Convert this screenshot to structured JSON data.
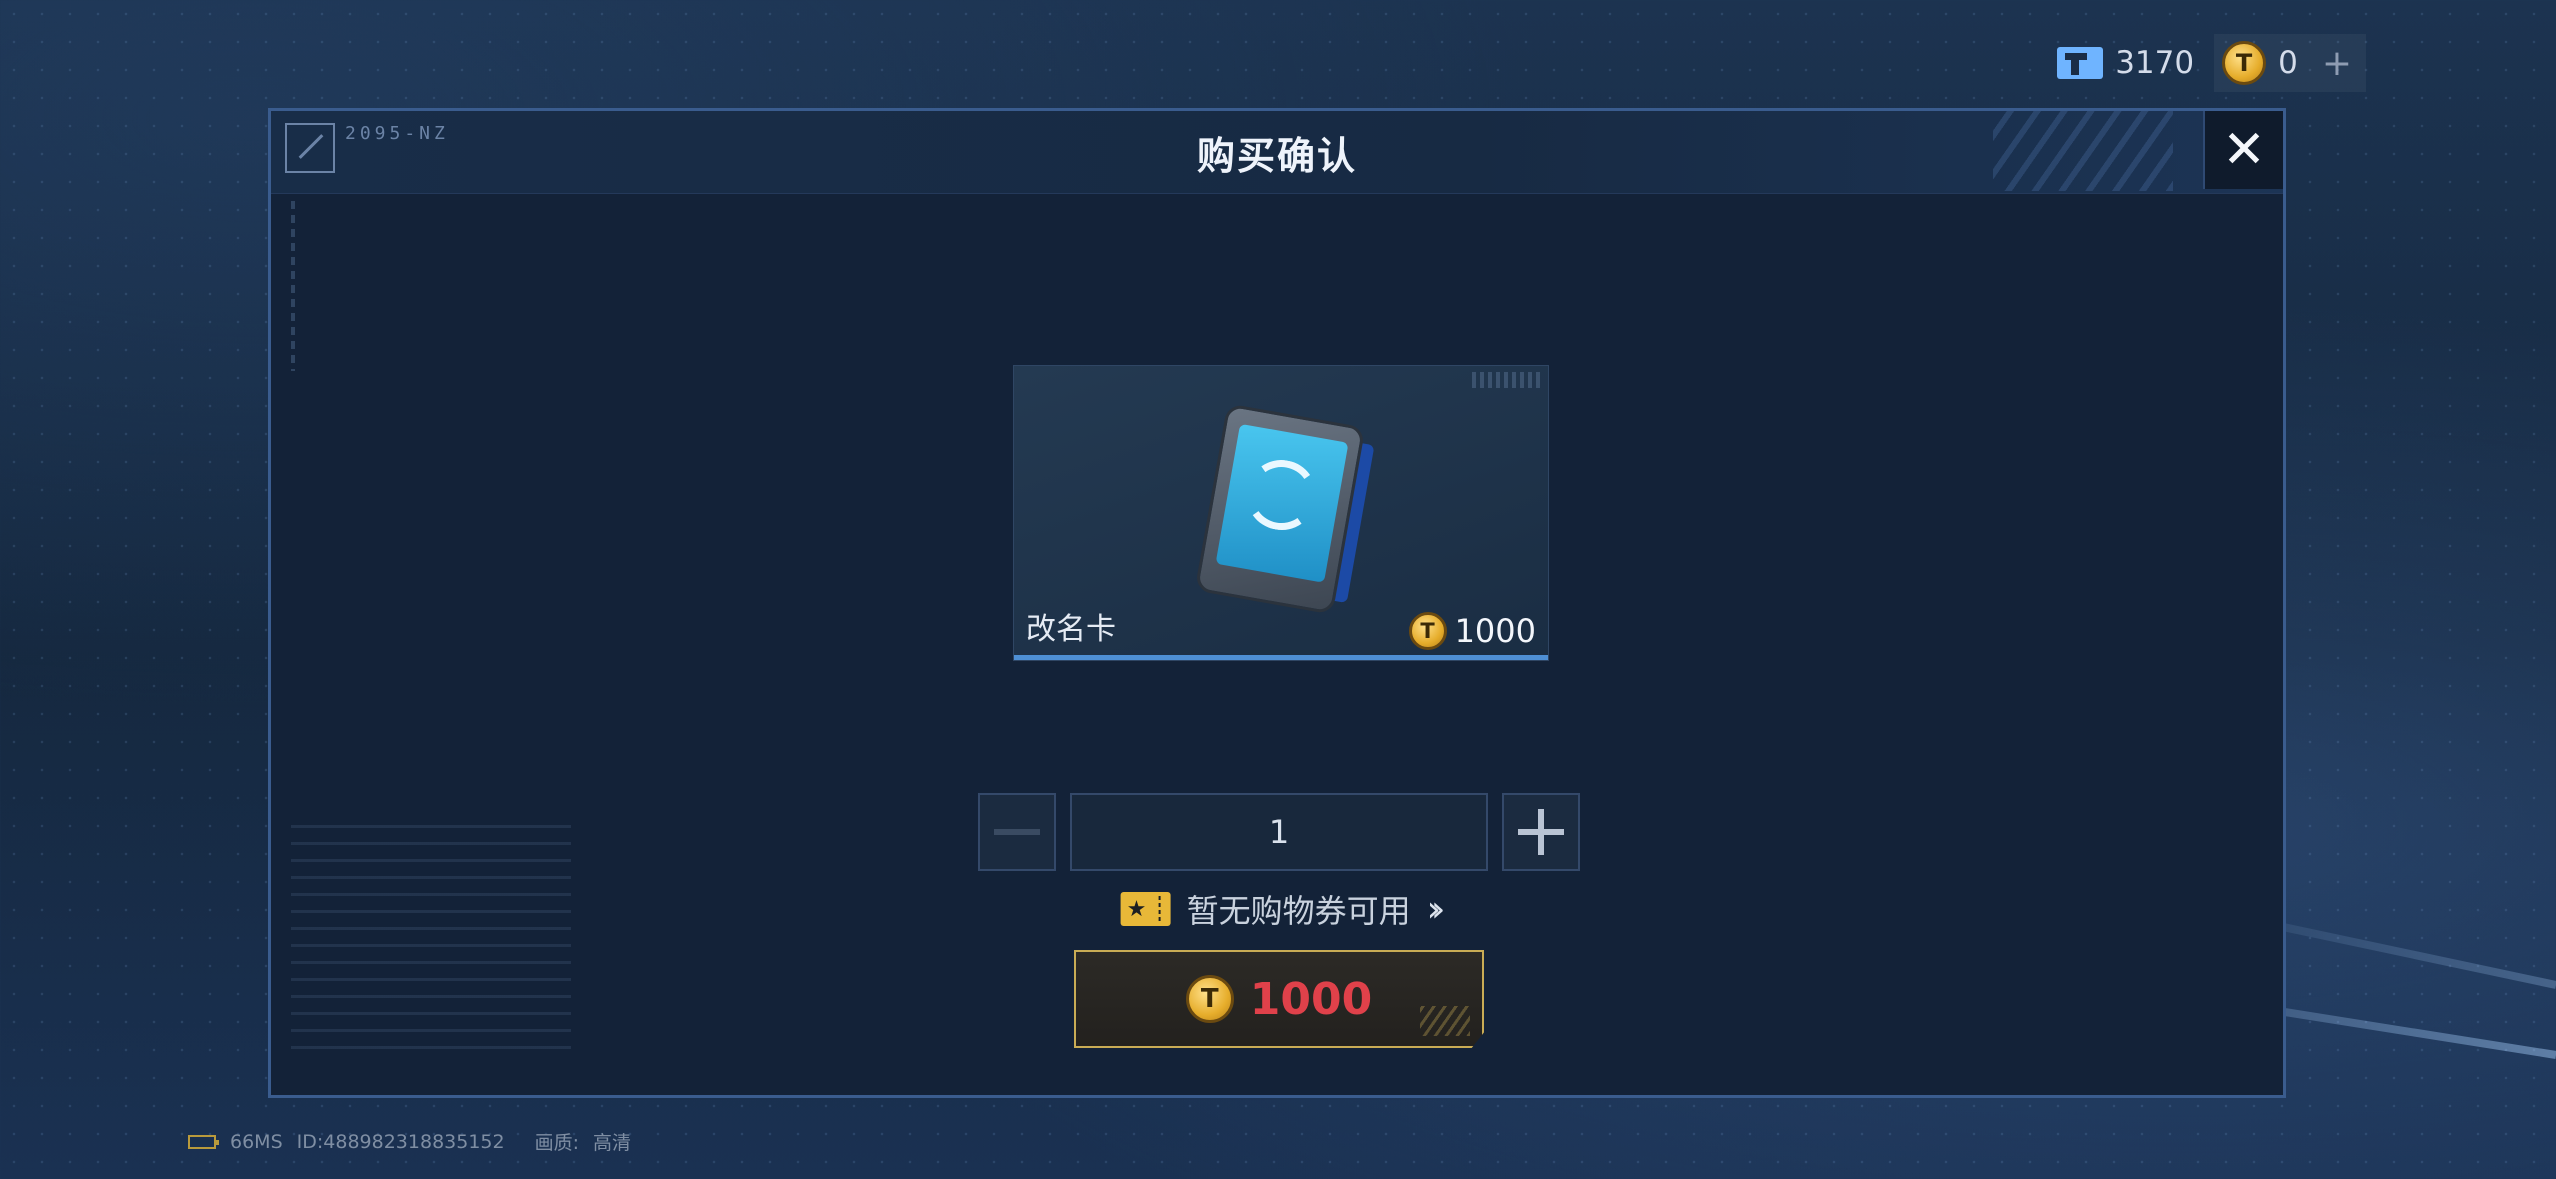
{
  "currency": {
    "ticket_amount": "3170",
    "coin_amount": "0",
    "add_symbol": "+"
  },
  "dialog": {
    "title": "购买确认",
    "close_symbol": "✕",
    "logo_text": "2095-NZ"
  },
  "item": {
    "name": "改名卡",
    "price": "1000"
  },
  "quantity": {
    "value": "1"
  },
  "coupon": {
    "text": "暂无购物券可用"
  },
  "buy_button": {
    "price": "1000"
  },
  "status_bar": {
    "ping": "66MS",
    "player_id": "ID:488982318835152",
    "quality_label": "画质:",
    "quality_value": "高清"
  },
  "colors": {
    "accent_blue": "#4e8fd4",
    "price_red": "#e0414a",
    "gold": "#c9ac55"
  }
}
